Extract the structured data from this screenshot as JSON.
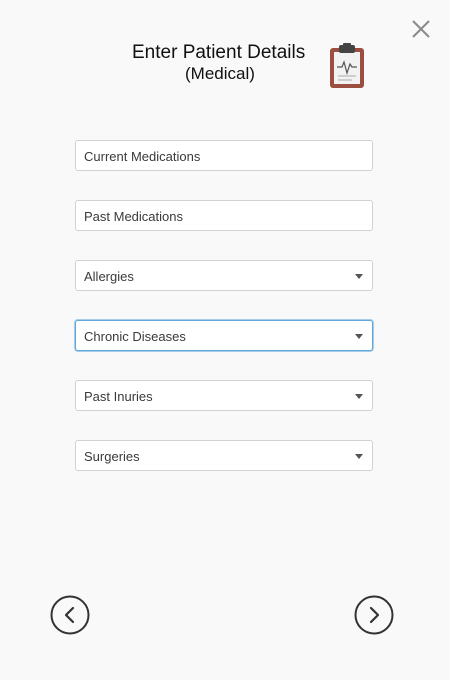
{
  "dialog": {
    "title": "Enter Patient Details",
    "subtitle": "(Medical)"
  },
  "fields": {
    "current_medications": {
      "placeholder": "Current Medications"
    },
    "past_medications": {
      "placeholder": "Past Medications"
    },
    "allergies": {
      "placeholder": "Allergies"
    },
    "chronic_diseases": {
      "placeholder": "Chronic Diseases"
    },
    "past_injuries": {
      "placeholder": "Past Inuries"
    },
    "surgeries": {
      "placeholder": "Surgeries"
    }
  },
  "icons": {
    "close": "close-icon",
    "clipboard": "clipboard-icon",
    "back": "chevron-left-icon",
    "next": "chevron-right-icon",
    "dropdown": "chevron-down-icon"
  },
  "colors": {
    "background": "#f9f9f9",
    "focus_border": "#62a8d8",
    "nav_circle": "#333333",
    "clipboard": "#9c4e40"
  }
}
